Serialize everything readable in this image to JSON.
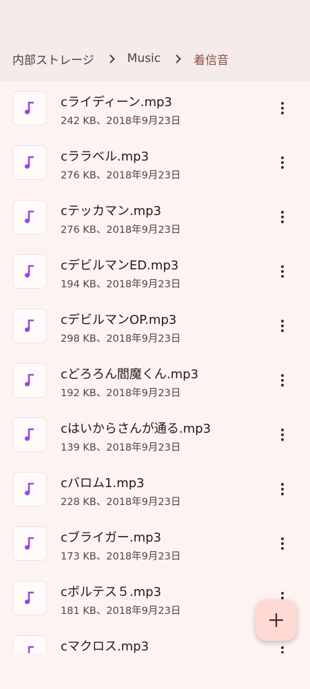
{
  "breadcrumb": {
    "items": [
      {
        "label": "内部ストレージ"
      },
      {
        "label": "Music"
      },
      {
        "label": "着信音"
      }
    ]
  },
  "files": [
    {
      "name": "cライディーン.mp3",
      "meta": "242 KB、2018年9月23日"
    },
    {
      "name": "cララベル.mp3",
      "meta": "276 KB、2018年9月23日"
    },
    {
      "name": "cテッカマン.mp3",
      "meta": "276 KB、2018年9月23日"
    },
    {
      "name": "cデビルマンED.mp3",
      "meta": "194 KB、2018年9月23日"
    },
    {
      "name": "cデビルマンOP.mp3",
      "meta": "298 KB、2018年9月23日"
    },
    {
      "name": "cどろろん閻魔くん.mp3",
      "meta": "192 KB、2018年9月23日"
    },
    {
      "name": "cはいからさんが通る.mp3",
      "meta": "139 KB、2018年9月23日"
    },
    {
      "name": "cバロム1.mp3",
      "meta": "228 KB、2018年9月23日"
    },
    {
      "name": "cブライガー.mp3",
      "meta": "173 KB、2018年9月23日"
    },
    {
      "name": "cボルテス５.mp3",
      "meta": "181 KB、2018年9月23日"
    },
    {
      "name": "cマクロス.mp3",
      "meta": ""
    }
  ],
  "icons": {
    "file": "music-note-icon",
    "more": "more-vert-icon",
    "fab": "plus-icon",
    "separator": "chevron-right-icon"
  },
  "colors": {
    "background": "#fdf3f1",
    "header": "#f5ebe9",
    "accent_text": "#8f4c43",
    "music_icon": "#9747e6",
    "fab": "#ffdad4"
  }
}
